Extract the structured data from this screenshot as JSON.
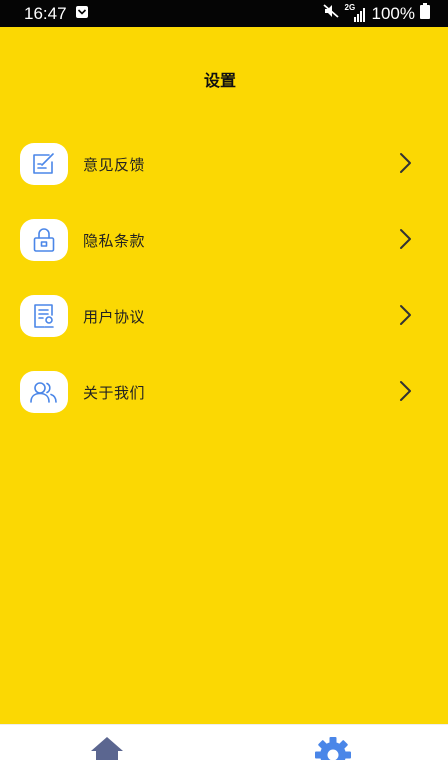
{
  "status_bar": {
    "time": "16:47",
    "network": "2G",
    "battery": "100%"
  },
  "header": {
    "title": "设置"
  },
  "settings": {
    "items": [
      {
        "label": "意见反馈",
        "icon": "feedback-icon"
      },
      {
        "label": "隐私条款",
        "icon": "lock-icon"
      },
      {
        "label": "用户协议",
        "icon": "agreement-icon"
      },
      {
        "label": "关于我们",
        "icon": "people-icon"
      }
    ]
  },
  "tabs": [
    {
      "icon": "home-icon"
    },
    {
      "icon": "gear-icon"
    }
  ],
  "colors": {
    "background": "#fbd803",
    "icon_blue": "#4a86e8",
    "status_bar": "#050505"
  }
}
